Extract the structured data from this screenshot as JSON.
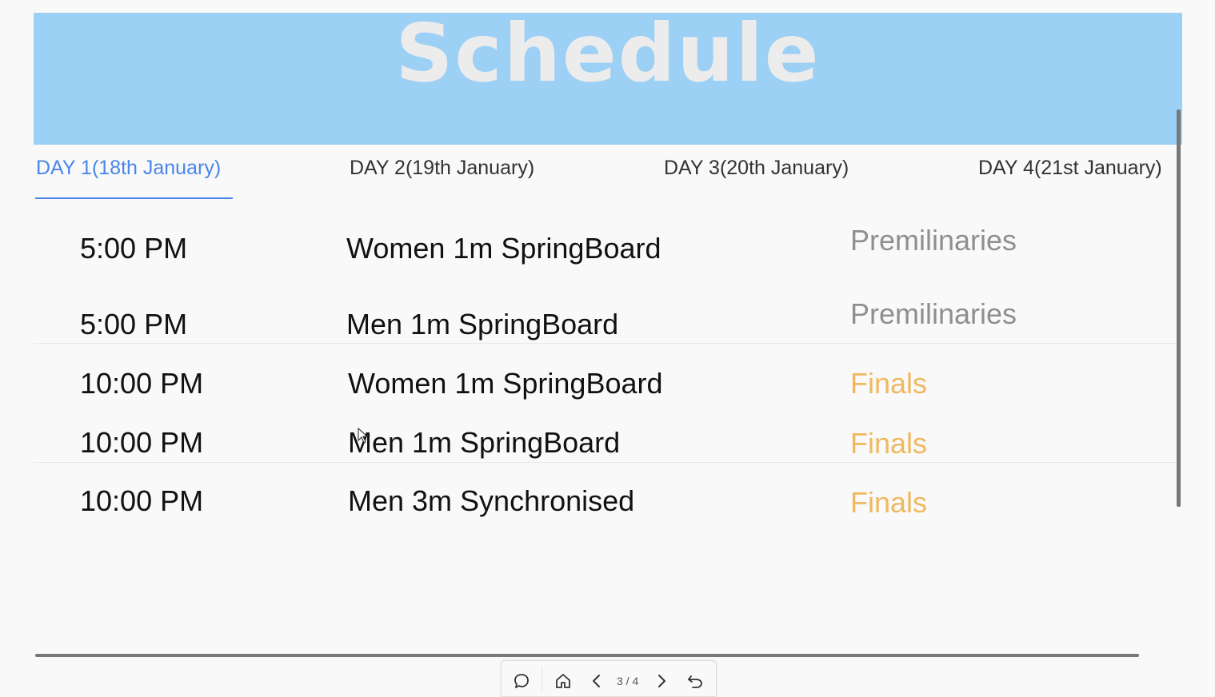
{
  "header": {
    "title": "Schedule",
    "background": "#9dd0f5"
  },
  "tabs": [
    {
      "label": "DAY 1(18th January)",
      "active": true
    },
    {
      "label": "DAY 2(19th January)",
      "active": false
    },
    {
      "label": "DAY 3(20th January)",
      "active": false
    },
    {
      "label": "DAY 4(21st January)",
      "active": false
    }
  ],
  "schedule": [
    {
      "time": "5:00 PM",
      "event": "Women 1m SpringBoard",
      "stage": "Premilinaries"
    },
    {
      "time": "5:00 PM",
      "event": "Men 1m SpringBoard",
      "stage": "Premilinaries"
    },
    {
      "time": "10:00 PM",
      "event": "Women 1m SpringBoard",
      "stage": "Finals"
    },
    {
      "time": "10:00 PM",
      "event": "Men 1m SpringBoard",
      "stage": "Finals"
    },
    {
      "time": "10:00 PM",
      "event": "Men 3m Synchronised",
      "stage": "Finals"
    }
  ],
  "colors": {
    "active_tab": "#4a86e8",
    "prelim": "#8f8f8f",
    "final": "#f0b860"
  },
  "toolbar": {
    "page_indicator": "3 / 4",
    "icons": [
      "comment-icon",
      "home-icon",
      "chevron-left-icon",
      "chevron-right-icon",
      "undo-icon"
    ]
  }
}
